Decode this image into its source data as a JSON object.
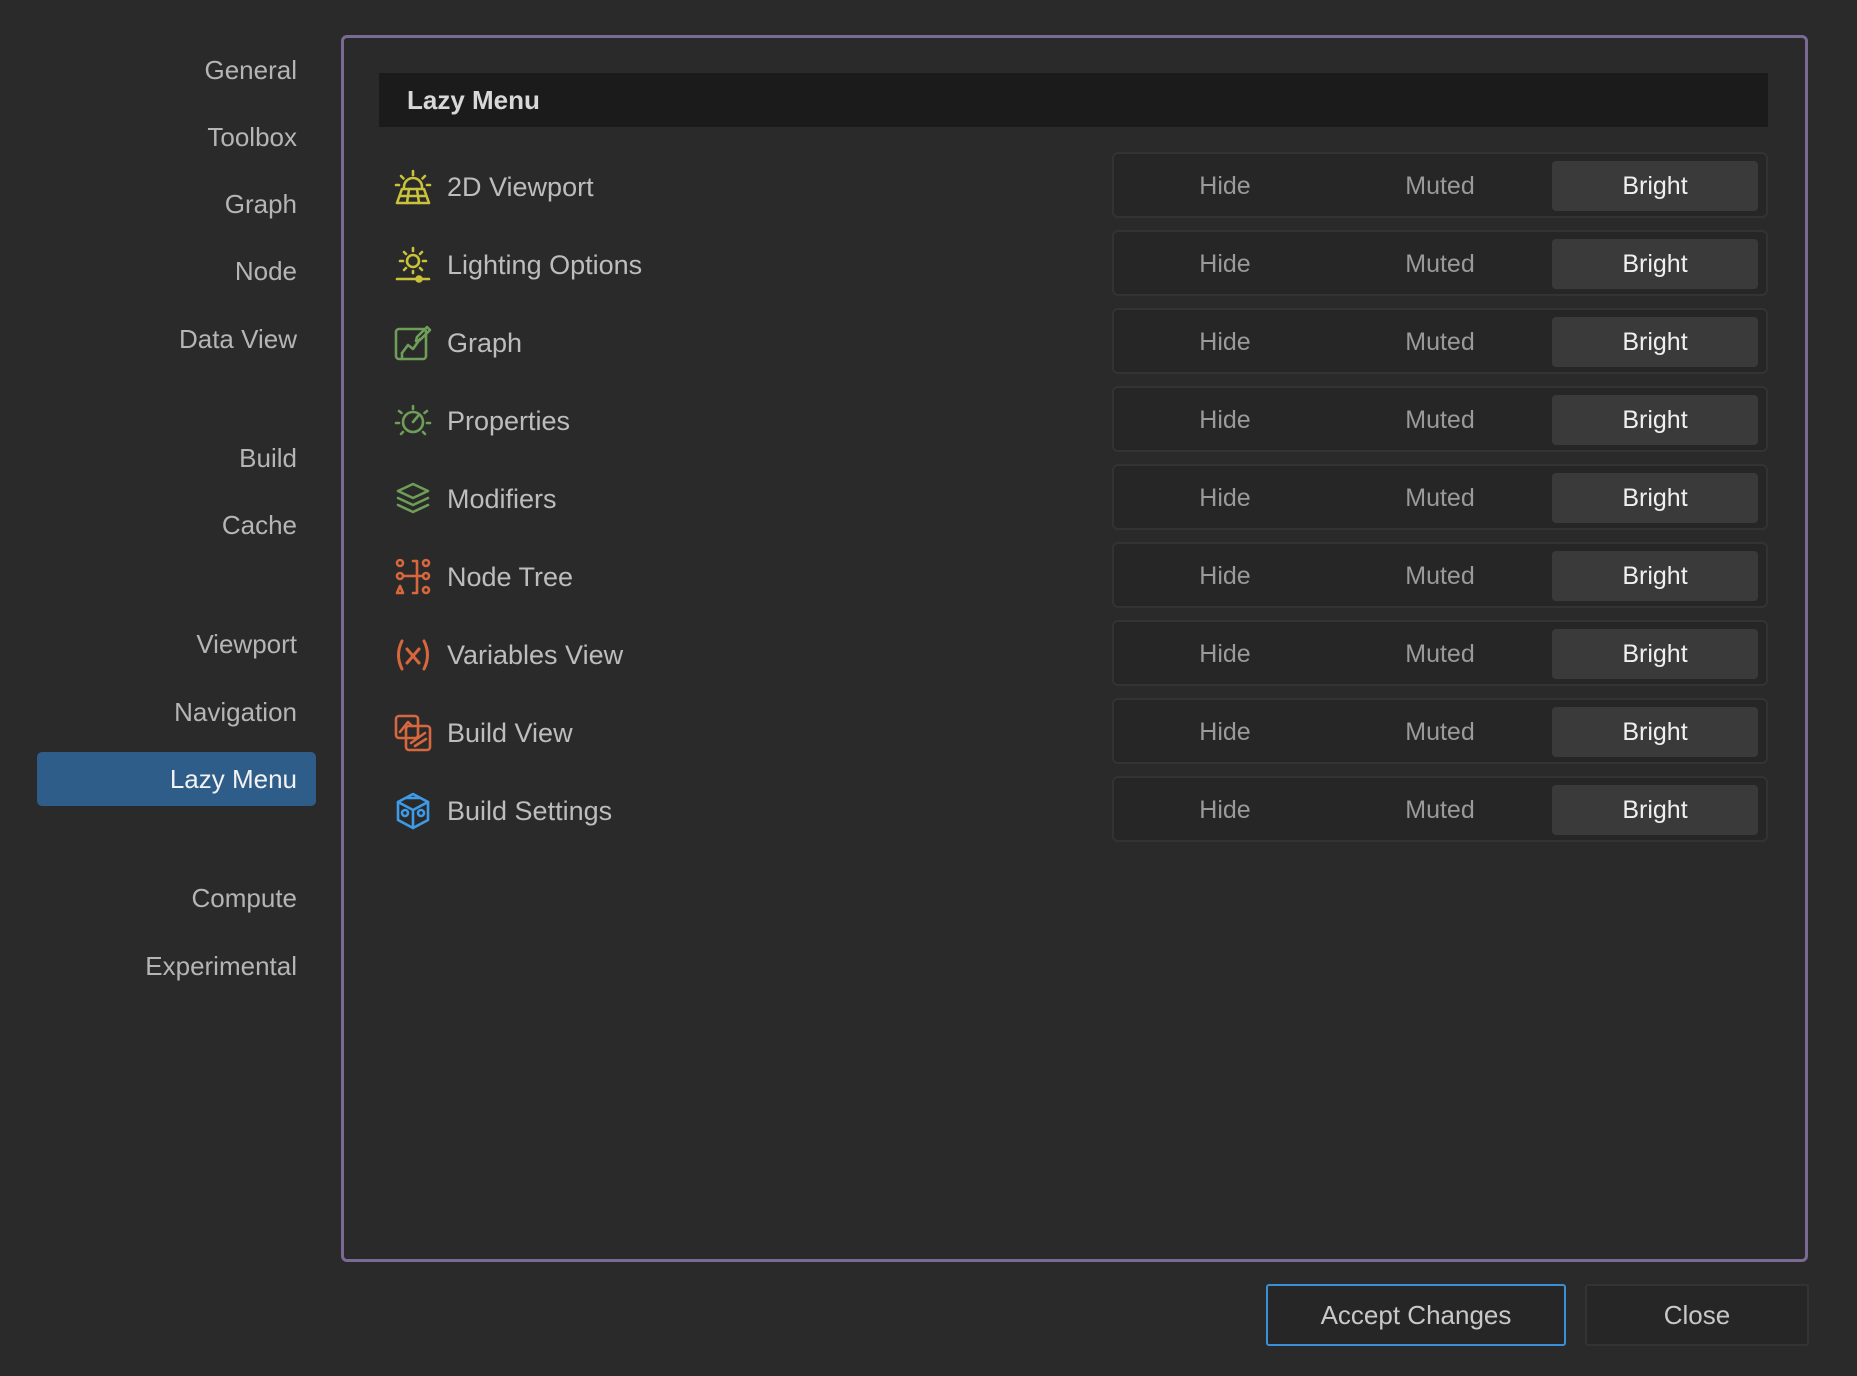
{
  "sidebar": {
    "items": [
      {
        "label": "General"
      },
      {
        "label": "Toolbox"
      },
      {
        "label": "Graph"
      },
      {
        "label": "Node"
      },
      {
        "label": "Data View"
      },
      {
        "label": "Build"
      },
      {
        "label": "Cache"
      },
      {
        "label": "Viewport"
      },
      {
        "label": "Navigation"
      },
      {
        "label": "Lazy Menu",
        "active": true
      },
      {
        "label": "Compute"
      },
      {
        "label": "Experimental"
      }
    ]
  },
  "panel": {
    "title": "Lazy Menu",
    "options": [
      "Hide",
      "Muted",
      "Bright"
    ],
    "selected_option": "Bright",
    "rows": [
      {
        "label": "2D Viewport",
        "icon": "viewport-sun-grid-icon",
        "color": "#c9c23a"
      },
      {
        "label": "Lighting Options",
        "icon": "lighting-sun-icon",
        "color": "#c9c23a"
      },
      {
        "label": "Graph",
        "icon": "graph-edit-icon",
        "color": "#6e9e58"
      },
      {
        "label": "Properties",
        "icon": "properties-gauge-icon",
        "color": "#6e9e58"
      },
      {
        "label": "Modifiers",
        "icon": "layers-stack-icon",
        "color": "#6e9e58"
      },
      {
        "label": "Node Tree",
        "icon": "node-tree-icon",
        "color": "#d9673e"
      },
      {
        "label": "Variables View",
        "icon": "variable-x-icon",
        "color": "#d9673e"
      },
      {
        "label": "Build View",
        "icon": "build-view-icon",
        "color": "#d9673e"
      },
      {
        "label": "Build Settings",
        "icon": "cube-settings-icon",
        "color": "#3d9be9"
      }
    ]
  },
  "footer": {
    "accept_label": "Accept Changes",
    "close_label": "Close"
  },
  "colors": {
    "background": "#2a2a2a",
    "panel_border": "#7b6a94",
    "active_nav": "#2f5d8a",
    "accept_border": "#3a8fd9"
  }
}
